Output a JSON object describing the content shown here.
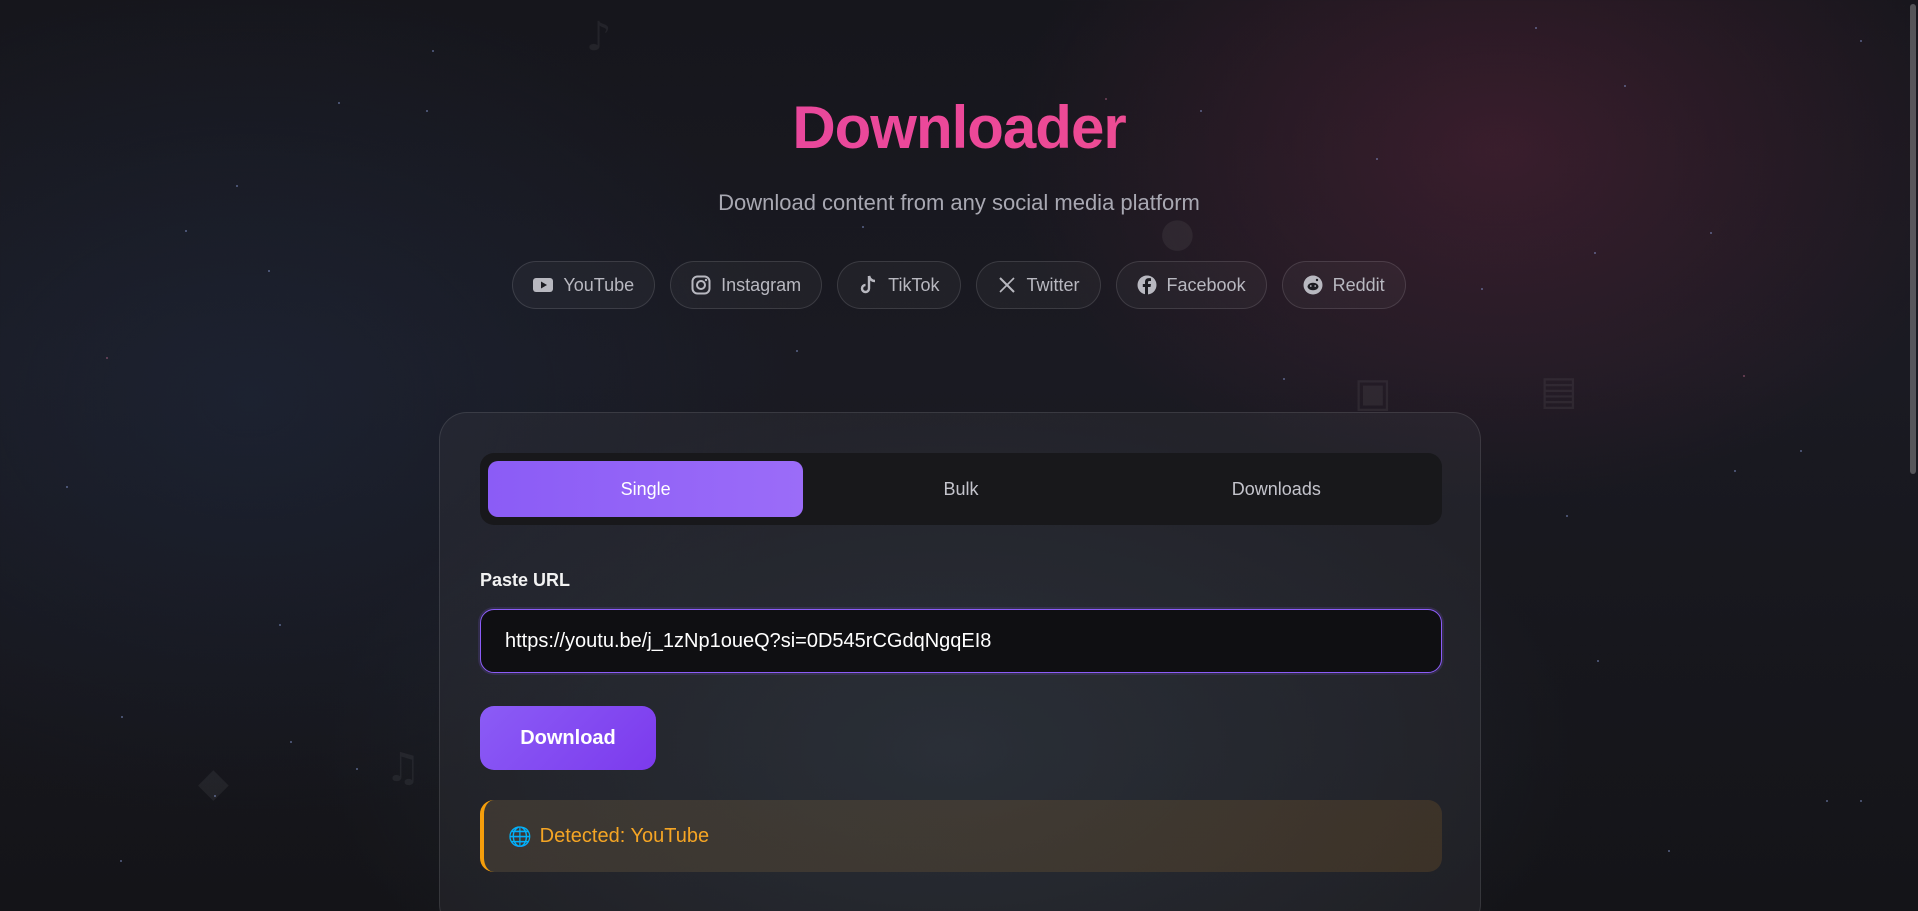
{
  "header": {
    "title": "Downloader",
    "subtitle": "Download content from any social media platform"
  },
  "platforms": [
    {
      "label": "YouTube",
      "icon": "youtube-icon"
    },
    {
      "label": "Instagram",
      "icon": "instagram-icon"
    },
    {
      "label": "TikTok",
      "icon": "tiktok-icon"
    },
    {
      "label": "Twitter",
      "icon": "x-twitter-icon"
    },
    {
      "label": "Facebook",
      "icon": "facebook-icon"
    },
    {
      "label": "Reddit",
      "icon": "reddit-icon"
    }
  ],
  "tabs": [
    {
      "label": "Single",
      "active": true
    },
    {
      "label": "Bulk",
      "active": false
    },
    {
      "label": "Downloads",
      "active": false
    }
  ],
  "form": {
    "url_label": "Paste URL",
    "url_value": "https://youtu.be/j_1zNp1oueQ?si=0D545rCGdqNgqEI8",
    "download_label": "Download"
  },
  "detection": {
    "icon": "globe-icon",
    "text": "Detected: YouTube"
  },
  "colors": {
    "accent": "#8b5cf6",
    "title_gradient_start": "#d946a8",
    "title_gradient_end": "#f25d7a",
    "warning": "#f59e0b"
  }
}
